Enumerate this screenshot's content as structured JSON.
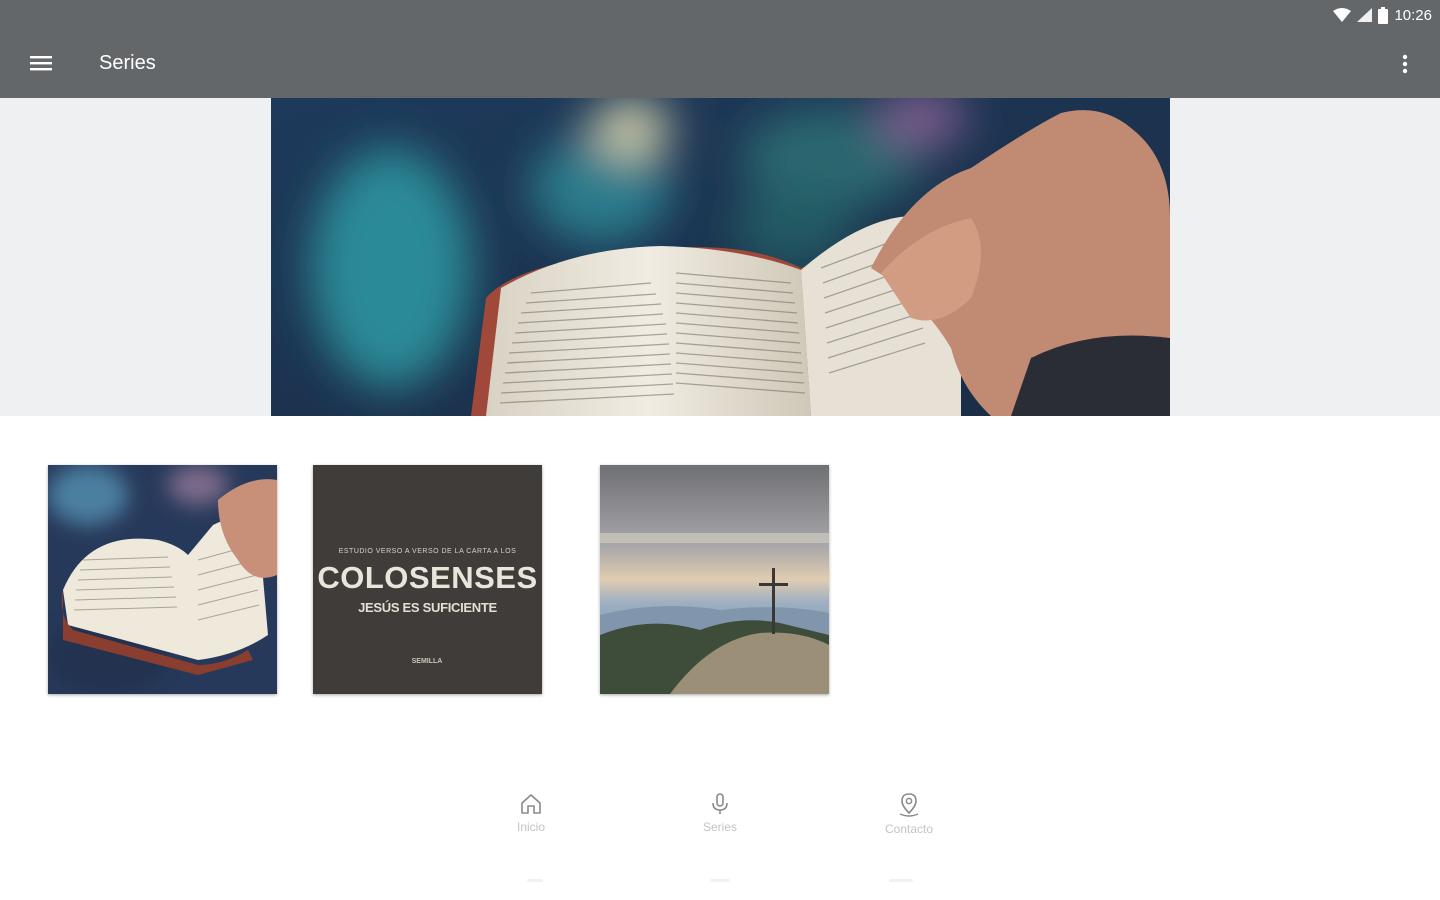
{
  "status_bar": {
    "time": "10:26"
  },
  "app_bar": {
    "title": "Series",
    "menu_icon": "hamburger-menu-icon",
    "overflow_icon": "more-vert-icon",
    "color": "#646769"
  },
  "hero": {
    "description_icon": "open-bible-photo"
  },
  "cards": [
    {
      "image": "bible-in-hand-photo"
    },
    {
      "image": "colosenses-cover",
      "small_text": "ESTUDIO VERSO A VERSO DE LA CARTA A LOS",
      "title": "COLOSENSES",
      "subtitle": "JESÚS ES SUFICIENTE",
      "logo": "SEMILLA"
    },
    {
      "image": "cross-on-mountain-photo"
    }
  ],
  "bottom_nav": {
    "items": [
      {
        "label": "Inicio",
        "icon": "home-icon"
      },
      {
        "label": "Series",
        "icon": "microphone-icon"
      },
      {
        "label": "Contacto",
        "icon": "location-pin-icon"
      }
    ]
  }
}
